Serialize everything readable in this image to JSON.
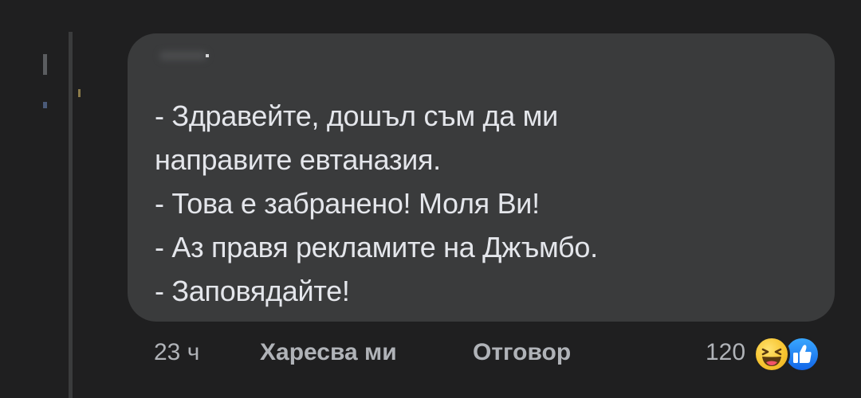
{
  "comment": {
    "lines": [
      "- Здравейте, дошъл съм да ми",
      "направите евтаназия.",
      "- Това е забранено! Моля Ви!",
      "- Аз правя рекламите на Джъмбо.",
      "- Заповядайте!"
    ]
  },
  "actions": {
    "timestamp": "23 ч",
    "like_label": "Харесва ми",
    "reply_label": "Отговор",
    "reaction_count": "120",
    "reaction_icons": [
      "haha-icon",
      "like-icon"
    ]
  },
  "colors": {
    "background": "#1f1f20",
    "bubble": "#3a3b3c",
    "text": "#e4e6eb",
    "secondary_text": "#b0b3b8",
    "like_blue": "#1877f2",
    "haha_yellow": "#f7c531"
  }
}
